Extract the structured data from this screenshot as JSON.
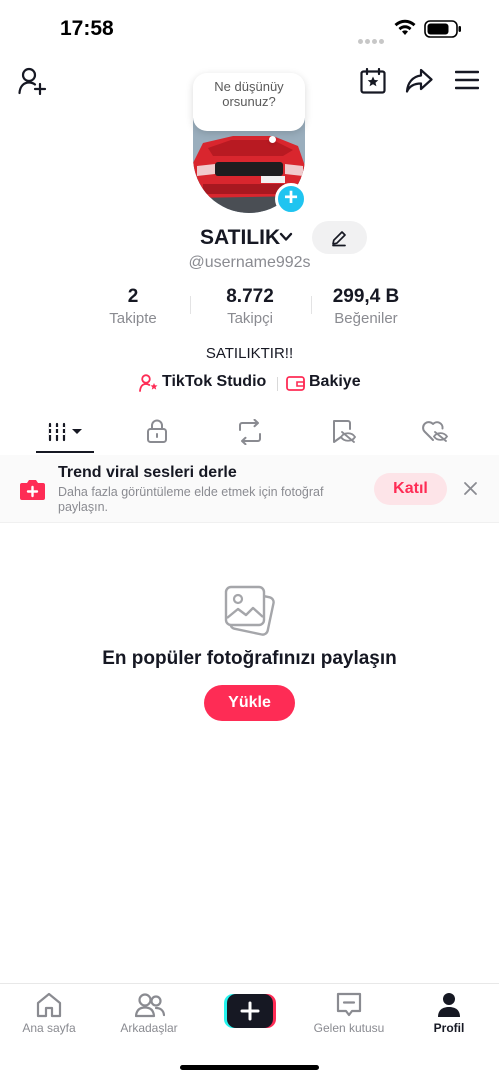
{
  "status_bar": {
    "time": "17:58"
  },
  "profile": {
    "thought_bubble": "Ne düşünüyorsunuz?",
    "display_name": "SATILIK",
    "username": "@username992s",
    "bio": "SATILIKTIR!!",
    "stats": [
      {
        "value": "2",
        "label": "Takipte"
      },
      {
        "value": "8.772",
        "label": "Takipçi"
      },
      {
        "value": "299,4 B",
        "label": "Beğeniler"
      }
    ],
    "links": [
      {
        "label": "TikTok Studio",
        "icon": "person-star-icon"
      },
      {
        "label": "Bakiye",
        "icon": "wallet-icon"
      }
    ]
  },
  "tabs": [
    {
      "name": "grid",
      "icon": "grid-icon",
      "active": true
    },
    {
      "name": "private",
      "icon": "lock-icon"
    },
    {
      "name": "reposts",
      "icon": "repost-icon"
    },
    {
      "name": "favorites",
      "icon": "bookmark-hidden-icon"
    },
    {
      "name": "liked",
      "icon": "heart-hidden-icon"
    }
  ],
  "banner": {
    "title": "Trend viral sesleri derle",
    "subtitle": "Daha fazla görüntüleme elde etmek için fotoğraf paylaşın.",
    "join_label": "Katıl"
  },
  "empty_state": {
    "title": "En popüler fotoğrafınızı paylaşın",
    "upload_label": "Yükle"
  },
  "bottom_nav": [
    {
      "label": "Ana sayfa",
      "icon": "home-icon"
    },
    {
      "label": "Arkadaşlar",
      "icon": "friends-icon"
    },
    {
      "label": "",
      "icon": "create-plus-icon"
    },
    {
      "label": "Gelen kutusu",
      "icon": "inbox-icon"
    },
    {
      "label": "Profil",
      "icon": "profile-icon",
      "active": true
    }
  ],
  "colors": {
    "accent": "#fe2c55",
    "cyan": "#20c4f0",
    "text": "#161823",
    "muted": "#8a8b91"
  }
}
